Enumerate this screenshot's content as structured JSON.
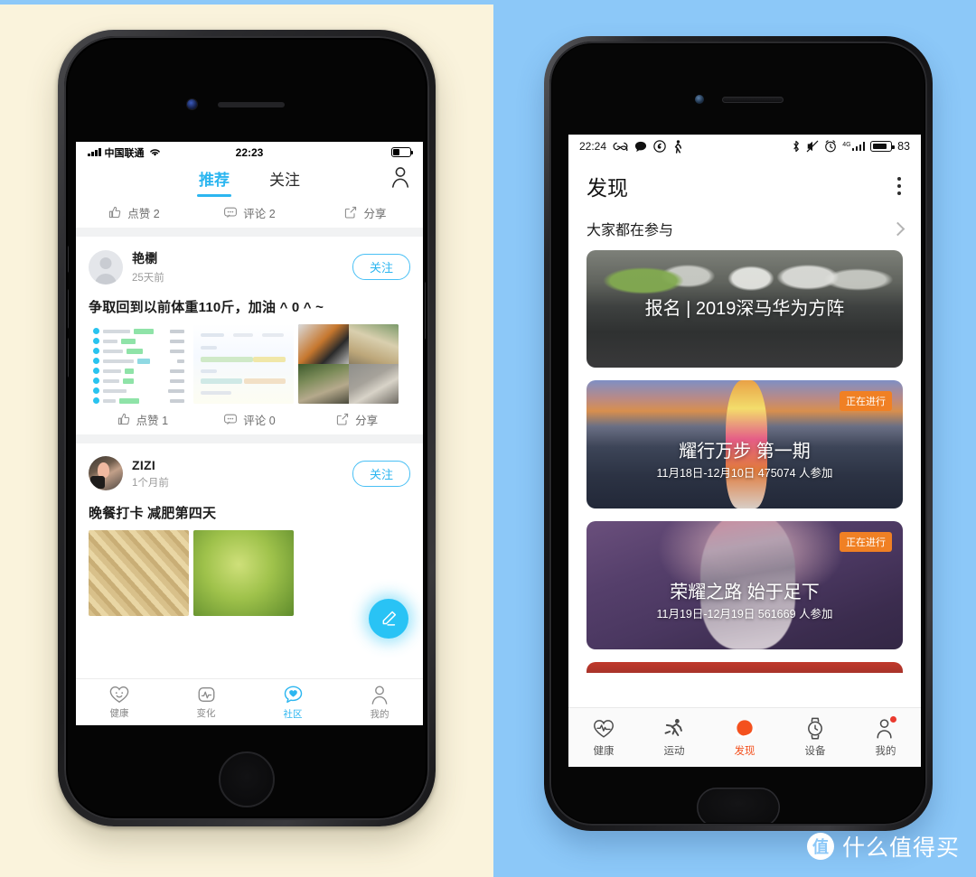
{
  "background": {
    "left_color": "#FAF3DC",
    "right_color": "#8CC8F8"
  },
  "left_phone": {
    "status": {
      "carrier": "中国联通",
      "time": "22:23",
      "wifi_icon": "wifi-icon",
      "battery_icon": "battery-icon"
    },
    "tabs": [
      {
        "label": "推荐",
        "active": true
      },
      {
        "label": "关注",
        "active": false
      }
    ],
    "profile_icon": "person-icon",
    "top_actions": [
      {
        "icon": "thumbs-up-icon",
        "label": "点赞 2"
      },
      {
        "icon": "comment-icon",
        "label": "评论 2"
      },
      {
        "icon": "share-icon",
        "label": "分享"
      }
    ],
    "posts": [
      {
        "user": "艳檦",
        "time": "25天前",
        "follow_label": "关注",
        "text": "争取回到以前体重110斤，加油 ^ 0 ^ ~",
        "actions": [
          {
            "icon": "thumbs-up-icon",
            "label": "点赞 1"
          },
          {
            "icon": "comment-icon",
            "label": "评论 0"
          },
          {
            "icon": "share-icon",
            "label": "分享"
          }
        ]
      },
      {
        "user": "ZIZI",
        "time": "1个月前",
        "follow_label": "关注",
        "text": "晚餐打卡 减肥第四天"
      }
    ],
    "compose_icon": "pencil-edit-icon",
    "bottom_nav": [
      {
        "icon": "heart-face-icon",
        "label": "健康",
        "active": false
      },
      {
        "icon": "chart-pulse-icon",
        "label": "变化",
        "active": false
      },
      {
        "icon": "community-heart-icon",
        "label": "社区",
        "active": true
      },
      {
        "icon": "person-icon",
        "label": "我的",
        "active": false
      }
    ],
    "accent_color": "#2CB6F0"
  },
  "right_phone": {
    "status": {
      "time": "22:24",
      "left_icons": [
        "infinity-icon",
        "message-icon",
        "music-icon",
        "pedestrian-icon"
      ],
      "right_icons": [
        "bluetooth-icon",
        "mute-icon",
        "alarm-icon",
        "signal-4g-icon",
        "battery-icon"
      ],
      "battery_percent": "83"
    },
    "header": {
      "title": "发现",
      "menu_icon": "kebab-menu-icon"
    },
    "section": {
      "title": "大家都在参与",
      "chevron_icon": "chevron-right-icon"
    },
    "cards": [
      {
        "title": "报名 | 2019深马华为方阵",
        "meta": "",
        "badge": "",
        "image": "marathon-runners-photo"
      },
      {
        "title": "耀行万步 第一期",
        "meta": "11月18日-12月10日   475074 人参加",
        "badge": "正在进行",
        "image": "female-runner-road-photo"
      },
      {
        "title": "荣耀之路 始于足下",
        "meta": "11月19日-12月19日   561669 人参加",
        "badge": "正在进行",
        "image": "hiker-purple-photo"
      }
    ],
    "badge_color": "#F08024",
    "bottom_nav": [
      {
        "icon": "heart-pulse-icon",
        "label": "健康",
        "active": false,
        "dot": false
      },
      {
        "icon": "runner-icon",
        "label": "运动",
        "active": false,
        "dot": false
      },
      {
        "icon": "discover-planet-icon",
        "label": "发现",
        "active": true,
        "dot": false
      },
      {
        "icon": "watch-icon",
        "label": "设备",
        "active": false,
        "dot": false
      },
      {
        "icon": "person-icon",
        "label": "我的",
        "active": false,
        "dot": true
      }
    ],
    "accent_color": "#F4511E"
  },
  "watermark": {
    "logo_char": "值",
    "text": "什么值得买"
  }
}
